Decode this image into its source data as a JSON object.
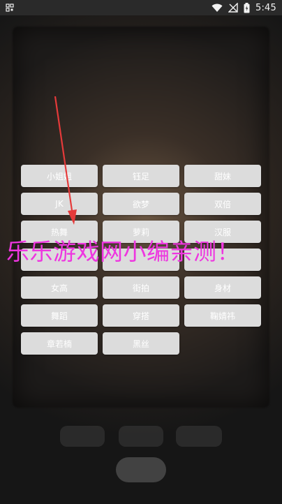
{
  "status_bar": {
    "time": "5:45"
  },
  "background_controls": [
    "",
    "",
    ""
  ],
  "tags": [
    "小姐姐",
    "钰足",
    "甜妹",
    "JK",
    "欲梦",
    "双倍",
    "热舞",
    "萝莉",
    "汉服",
    "",
    "",
    "",
    "女高",
    "街拍",
    "身材",
    "舞蹈",
    "穿搭",
    "鞠婧祎",
    "章若楠",
    "黑丝"
  ],
  "watermark": {
    "text": "乐乐游戏网小编亲测！",
    "color": "#ee36e0"
  },
  "colors": {
    "tag_bg": "#dcdcdc",
    "arrow": "#e53a3a"
  }
}
